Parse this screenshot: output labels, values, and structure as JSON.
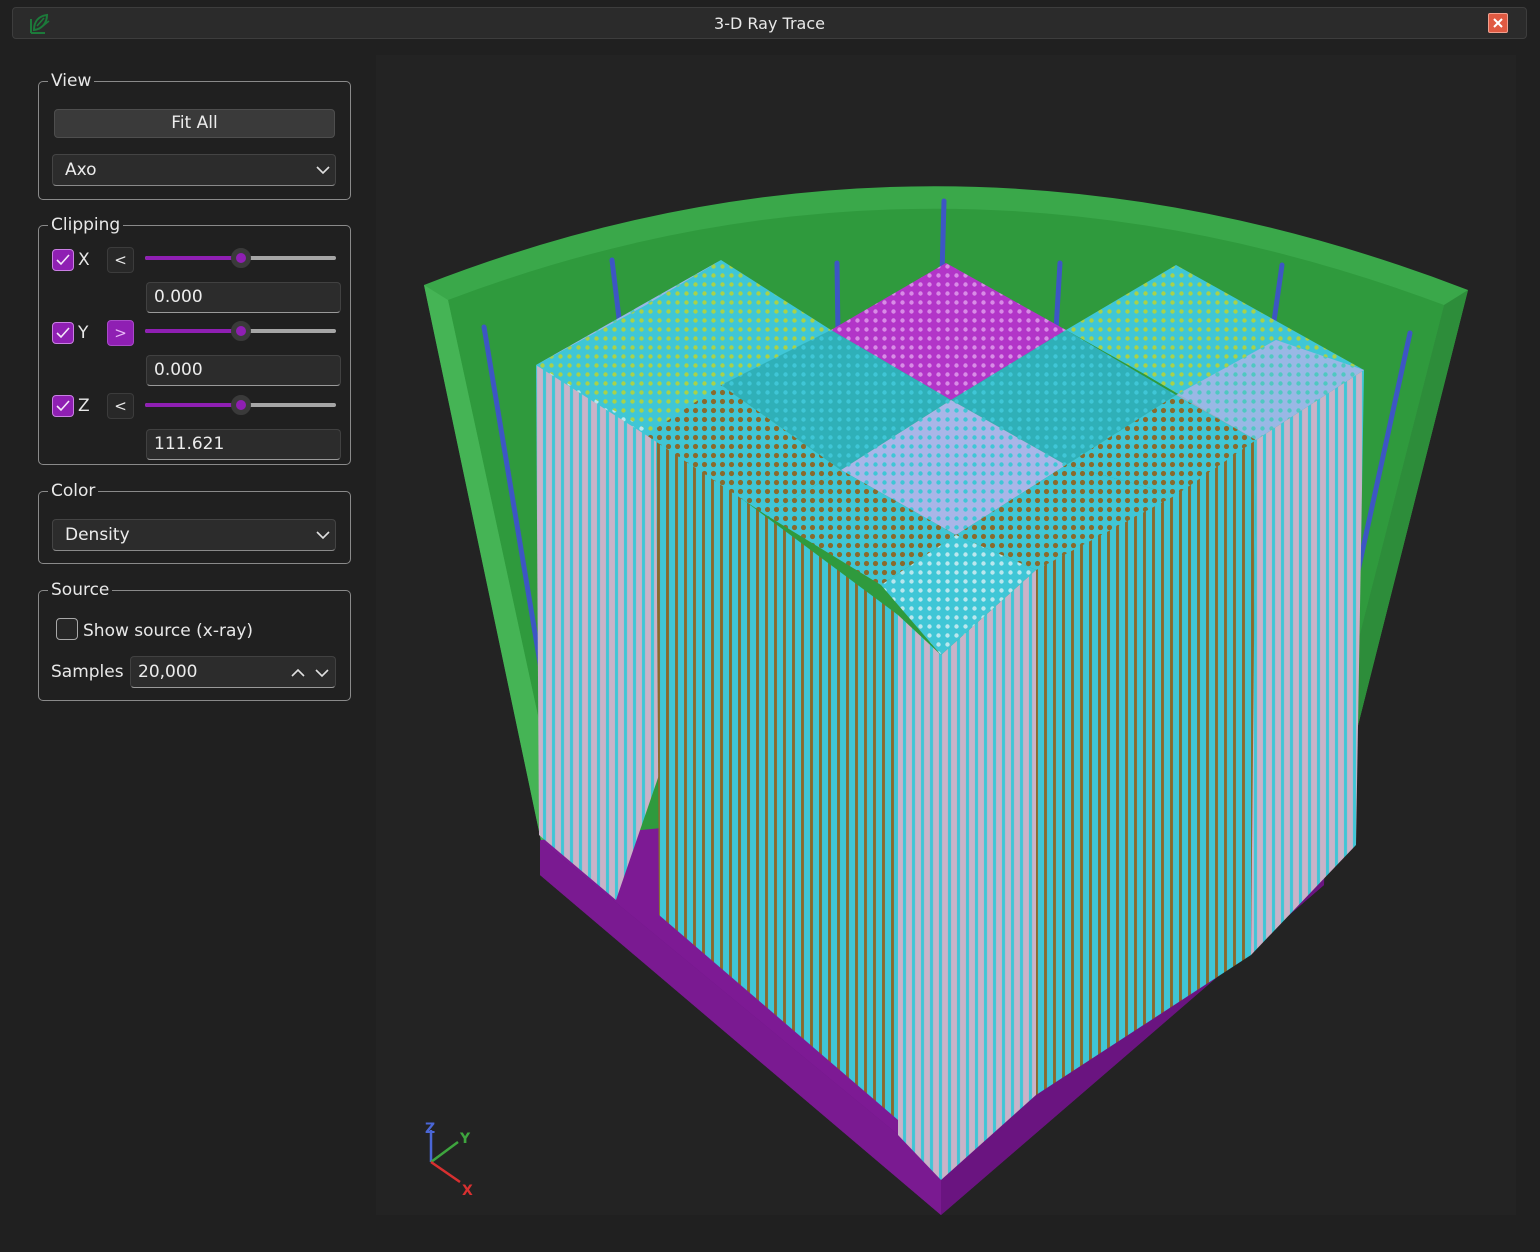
{
  "window": {
    "title": "3-D Ray Trace"
  },
  "view": {
    "legend": "View",
    "fit_all_label": "Fit All",
    "projection_value": "Axo"
  },
  "clipping": {
    "legend": "Clipping",
    "x": {
      "label": "X",
      "enabled": true,
      "direction": "<",
      "slider_fraction": 0.5,
      "value": "0.000"
    },
    "y": {
      "label": "Y",
      "enabled": true,
      "direction": ">",
      "slider_fraction": 0.5,
      "value": "0.000"
    },
    "z": {
      "label": "Z",
      "enabled": true,
      "direction": "<",
      "slider_fraction": 0.5,
      "value": "111.621"
    }
  },
  "color": {
    "legend": "Color",
    "mode_value": "Density"
  },
  "source": {
    "legend": "Source",
    "show_source_label": "Show source (x-ray)",
    "show_source_checked": false,
    "samples_label": "Samples",
    "samples_value": "20,000"
  },
  "axes_triad": {
    "z_label": "Z",
    "y_label": "Y",
    "x_label": "X"
  },
  "colors": {
    "accent": "#8f1fb3",
    "vessel_green": "#3aa84a",
    "base_purple": "#7d1a94",
    "fuel_cyan": "#3fc6d6",
    "rod_pink": "#c9b3c8",
    "absorber_brown": "#8a6a2c",
    "top_magenta": "#b235c8",
    "top_yellowgreen": "#a8d24a",
    "top_lavender": "#a9b6e8",
    "control_rod_blue": "#3d56c4"
  }
}
